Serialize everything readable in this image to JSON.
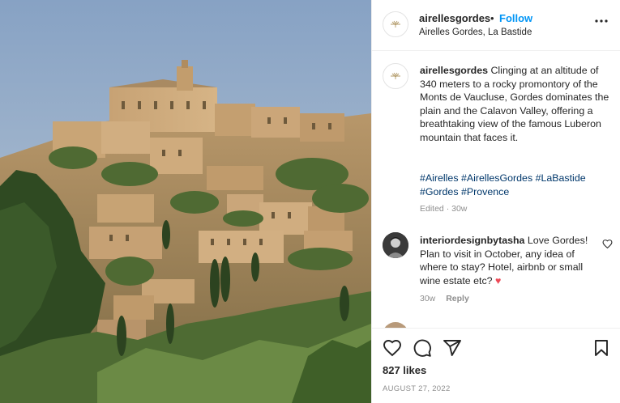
{
  "post": {
    "username": "airellesgordes",
    "dot": "•",
    "follow_label": "Follow",
    "location": "Airelles Gordes, La Bastide",
    "more_icon": "more-horizontal-icon"
  },
  "caption": {
    "username": "airellesgordes",
    "text": "Clinging at an altitude of 340 meters to a rocky promontory of the Monts de Vaucluse, Gordes dominates the plain and the Calavon Valley, offering a breathtaking view of the famous Luberon mountain that faces it.",
    "hashtags": [
      "#Airelles",
      "#AirellesGordes",
      "#LaBastide",
      "#Gordes",
      "#Provence"
    ],
    "meta": "Edited · 30w"
  },
  "comments": [
    {
      "username": "interiordesignbytasha",
      "text": "Love Gordes! Plan to visit in October, any idea of where to stay? Hotel, airbnb or small wine estate etc?",
      "emoji": "♥",
      "time": "30w",
      "reply_label": "Reply"
    }
  ],
  "actions": {
    "likes": "827 likes",
    "date": "AUGUST 27, 2022"
  },
  "colors": {
    "accent": "#0095f6",
    "hashtag": "#00376b",
    "muted": "#8e8e8e",
    "heart": "#ed4956",
    "sky": "#8aa6c6",
    "stone": "#c9a77a"
  }
}
